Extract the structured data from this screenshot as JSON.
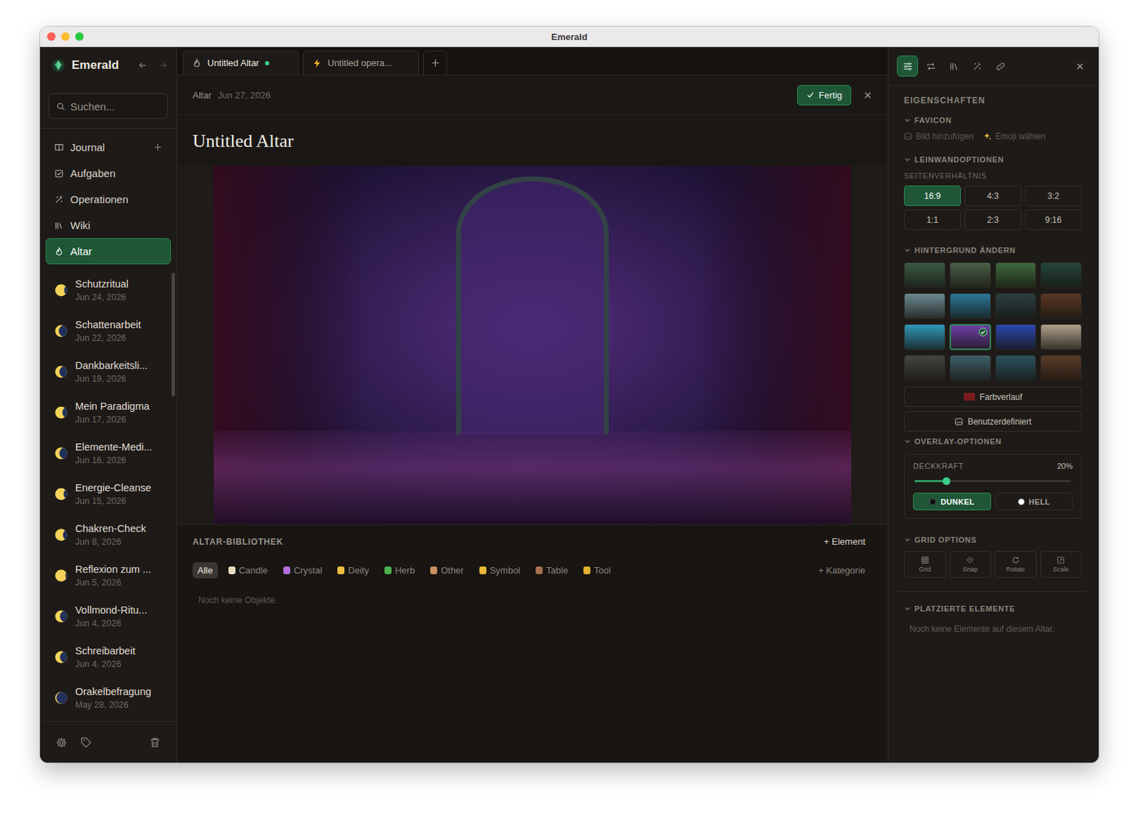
{
  "window": {
    "title": "Emerald"
  },
  "sidebar": {
    "app_name": "Emerald",
    "search": {
      "placeholder": "Suchen..."
    },
    "nav": [
      {
        "label": "Journal",
        "selected": false,
        "kind": "addable"
      },
      {
        "label": "Aufgaben",
        "selected": false,
        "kind": "plain"
      },
      {
        "label": "Operationen",
        "selected": false,
        "kind": "plain"
      },
      {
        "label": "Wiki",
        "selected": false,
        "kind": "plain"
      },
      {
        "label": "Altar",
        "selected": true,
        "kind": "plain"
      }
    ],
    "entries": [
      {
        "title": "Schutzritual",
        "date": "Jun 24, 2026",
        "phase": 0.75
      },
      {
        "title": "Schattenarbeit",
        "date": "Jun 22, 2026",
        "phase": 0.3
      },
      {
        "title": "Dankbarkeitsli...",
        "date": "Jun 19, 2026",
        "phase": 0.35
      },
      {
        "title": "Mein Paradigma",
        "date": "Jun 17, 2026",
        "phase": 0.6
      },
      {
        "title": "Elemente-Medi...",
        "date": "Jun 16, 2026",
        "phase": 0.35
      },
      {
        "title": "Energie-Cleanse",
        "date": "Jun 15, 2026",
        "phase": 0.7
      },
      {
        "title": "Chakren-Check",
        "date": "Jun 8, 2026",
        "phase": 0.65
      },
      {
        "title": "Reflexion zum ...",
        "date": "Jun 5, 2026",
        "phase": 0.85
      },
      {
        "title": "Vollmond-Ritu...",
        "date": "Jun 4, 2026",
        "phase": 0.4
      },
      {
        "title": "Schreibarbeit",
        "date": "Jun 4, 2026",
        "phase": 0.4
      },
      {
        "title": "Orakelbefragung",
        "date": "May 28, 2026",
        "phase": 0.1
      }
    ]
  },
  "tabs": [
    {
      "label": "Untitled Altar",
      "selected": true,
      "unsaved": true,
      "kind": "altar"
    },
    {
      "label": "Untitled opera...",
      "selected": false,
      "unsaved": false,
      "kind": "operation"
    }
  ],
  "document": {
    "breadcrumb": "Altar",
    "date": "Jun 27, 2026",
    "done_button": "Fertig",
    "title": "Untitled Altar"
  },
  "library": {
    "title": "ALTAR-BIBLIOTHEK",
    "add_element": "+ Element",
    "categories": [
      {
        "label": "Alle",
        "selected": true
      },
      {
        "label": "Candle",
        "selected": false
      },
      {
        "label": "Crystal",
        "selected": false
      },
      {
        "label": "Deity",
        "selected": false
      },
      {
        "label": "Herb",
        "selected": false
      },
      {
        "label": "Other",
        "selected": false
      },
      {
        "label": "Symbol",
        "selected": false
      },
      {
        "label": "Table",
        "selected": false
      },
      {
        "label": "Tool",
        "selected": false
      }
    ],
    "add_category": "+ Kategorie",
    "empty": "Noch keine Objekte."
  },
  "panel": {
    "tools": [
      {
        "selected": true
      },
      {
        "selected": false
      },
      {
        "selected": false
      },
      {
        "selected": false
      },
      {
        "selected": false
      }
    ],
    "heading": "EIGENSCHAFTEN",
    "favicon": {
      "title": "FAVICON",
      "expanded": true,
      "add_image": "Bild hinzufügen",
      "emoji": "Emoji wählen"
    },
    "canvas": {
      "title": "LEINWANDOPTIONEN",
      "expanded": true,
      "label": "SEITENVERHÄLTNIS",
      "ratios": [
        {
          "label": "16:9",
          "selected": true
        },
        {
          "label": "4:3",
          "selected": false
        },
        {
          "label": "3:2",
          "selected": false
        },
        {
          "label": "1:1",
          "selected": false
        },
        {
          "label": "2:3",
          "selected": false
        },
        {
          "label": "9:16",
          "selected": false
        }
      ]
    },
    "background": {
      "title": "HINTERGRUND ÄNDERN",
      "expanded": true,
      "thumbnails": [
        {
          "color": "#3a5a44",
          "selected": false
        },
        {
          "color": "#4a6048",
          "selected": false
        },
        {
          "color": "#3f6a3c",
          "selected": false
        },
        {
          "color": "#24463a",
          "selected": false
        },
        {
          "color": "#6a8a90",
          "selected": false
        },
        {
          "color": "#2a7898",
          "selected": false
        },
        {
          "color": "#2c3e40",
          "selected": false
        },
        {
          "color": "#5a3824",
          "selected": false
        },
        {
          "color": "#3098b8",
          "selected": false
        },
        {
          "color": "#7040a8",
          "selected": true
        },
        {
          "color": "#2c48b0",
          "selected": false
        },
        {
          "color": "#b0a08a",
          "selected": false
        },
        {
          "color": "#444440",
          "selected": false
        },
        {
          "color": "#3c6068",
          "selected": false
        },
        {
          "color": "#2c5260",
          "selected": false
        },
        {
          "color": "#5a3a26",
          "selected": false
        }
      ],
      "gradient": "Farbverlauf",
      "gradient_color": "#7a1c1c",
      "custom": "Benutzerdefiniert"
    },
    "overlay": {
      "title": "OVERLAY-OPTIONEN",
      "expanded": true,
      "opacity_label": "DECKKRAFT",
      "opacity_value": "20%",
      "level": 0.2,
      "modes": [
        {
          "label": "DUNKEL",
          "selected": true
        },
        {
          "label": "HELL",
          "selected": false
        }
      ]
    },
    "grid": {
      "title": "GRID OPTIONS",
      "expanded": true,
      "buttons": [
        "Grid",
        "Snap",
        "Rotate",
        "Scale"
      ]
    },
    "placed": {
      "title": "PLATZIERTE ELEMENTE",
      "expanded": true,
      "empty": "Noch keine Elemente auf diesem Altar."
    }
  }
}
